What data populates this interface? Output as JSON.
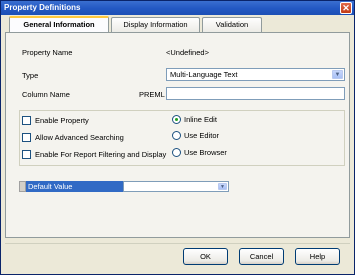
{
  "window": {
    "title": "Property Definitions",
    "close_label": "✕"
  },
  "tabs": [
    {
      "label": "General Information",
      "active": true
    },
    {
      "label": "Display Information",
      "active": false
    },
    {
      "label": "Validation",
      "active": false
    }
  ],
  "form": {
    "property_name_label": "Property Name",
    "property_name_value": "<Undefined>",
    "type_label": "Type",
    "type_value": "Multi-Language Text",
    "column_name_label": "Column Name",
    "column_prefix": "PREML",
    "column_value": ""
  },
  "options": {
    "enable_property": {
      "label": "Enable Property",
      "checked": false
    },
    "allow_advanced_searching": {
      "label": "Allow Advanced Searching",
      "checked": false
    },
    "enable_report_filtering": {
      "label": "Enable For Report Filtering and Display",
      "checked": false
    },
    "edit_modes": [
      {
        "label": "Inline Edit",
        "selected": true
      },
      {
        "label": "Use Editor",
        "selected": false
      },
      {
        "label": "Use Browser",
        "selected": false
      }
    ]
  },
  "default_value": {
    "label": "Default Value",
    "value": ""
  },
  "buttons": {
    "ok": "OK",
    "cancel": "Cancel",
    "help": "Help"
  }
}
